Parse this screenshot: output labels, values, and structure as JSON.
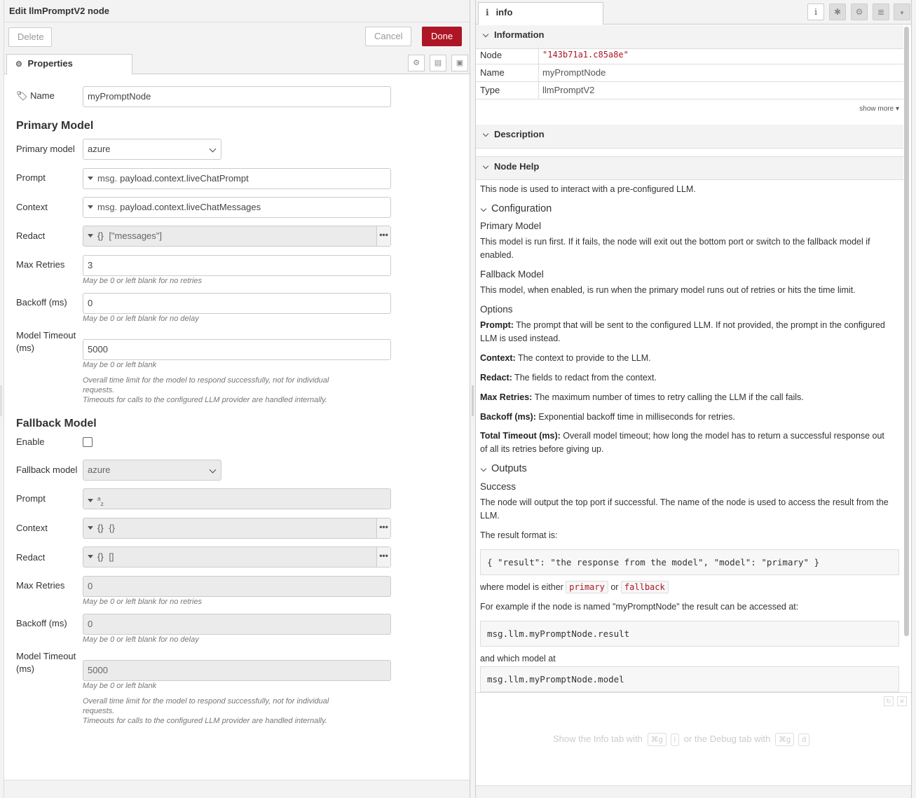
{
  "tray": {
    "title": "Edit llmPromptV2 node",
    "buttons": {
      "delete": "Delete",
      "cancel": "Cancel",
      "done": "Done"
    },
    "tab": "Properties",
    "name": {
      "label": "Name",
      "value": "myPromptNode"
    },
    "primary": {
      "heading": "Primary Model",
      "model_label": "Primary model",
      "model_value": "azure",
      "prompt_label": "Prompt",
      "prompt_type": "msg.",
      "prompt_value": "payload.context.liveChatPrompt",
      "context_label": "Context",
      "context_type": "msg.",
      "context_value": "payload.context.liveChatMessages",
      "redact_label": "Redact",
      "redact_type": "{}",
      "redact_value": "[\"messages\"]",
      "retries_label": "Max Retries",
      "retries_value": "3",
      "retries_help": "May be 0 or left blank for no retries",
      "backoff_label": "Backoff (ms)",
      "backoff_value": "0",
      "backoff_help": "May be 0 or left blank for no delay",
      "timeout_label_1": "Model Timeout",
      "timeout_label_2": "(ms)",
      "timeout_value": "5000",
      "timeout_help": "May be 0 or left blank",
      "timeout_note_1": "Overall time limit for the model to respond successfully, not for individual",
      "timeout_note_2": "requests.",
      "timeout_note_3": "Timeouts for calls to the configured LLM provider are handled internally."
    },
    "fallback": {
      "heading": "Fallback Model",
      "enable_label": "Enable",
      "model_label": "Fallback model",
      "model_value": "azure",
      "prompt_label": "Prompt",
      "prompt_type": "a",
      "prompt_type_sub": "z",
      "context_label": "Context",
      "context_type": "{}",
      "context_value": "{}",
      "redact_label": "Redact",
      "redact_type": "{}",
      "redact_value": "[]",
      "retries_label": "Max Retries",
      "retries_value": "0",
      "retries_help": "May be 0 or left blank for no retries",
      "backoff_label": "Backoff (ms)",
      "backoff_value": "0",
      "backoff_help": "May be 0 or left blank for no delay",
      "timeout_label_1": "Model Timeout",
      "timeout_label_2": "(ms)",
      "timeout_value": "5000",
      "timeout_help": "May be 0 or left blank",
      "timeout_note_1": "Overall time limit for the model to respond successfully, not for individual",
      "timeout_note_2": "requests.",
      "timeout_note_3": "Timeouts for calls to the configured LLM provider are handled internally."
    }
  },
  "sidebar": {
    "tab": "info",
    "information": {
      "heading": "Information",
      "rows": [
        {
          "key": "Node",
          "value": "\"143b71a1.c85a8e\""
        },
        {
          "key": "Name",
          "value": "myPromptNode"
        },
        {
          "key": "Type",
          "value": "llmPromptV2"
        }
      ],
      "show_more": "show more"
    },
    "description_heading": "Description",
    "help": {
      "heading": "Node Help",
      "intro": "This node is used to interact with a pre-configured LLM.",
      "configuration": "Configuration",
      "primary_h": "Primary Model",
      "primary_p1": "This model is run first. If it fails, the node will exit out the bottom port or switch to the fallback model if",
      "primary_p2": "enabled.",
      "fallback_h": "Fallback Model",
      "fallback_p": "This model, when enabled, is run when the primary model runs out of retries or hits the time limit.",
      "options_h": "Options",
      "prompt_b": "Prompt:",
      "prompt_t1": " The prompt that will be sent to the configured LLM. If not provided, the prompt in the configured",
      "prompt_t2": "LLM is used instead.",
      "context_b": "Context:",
      "context_t": " The context to provide to the LLM.",
      "redact_b": "Redact:",
      "redact_t": " The fields to redact from the context.",
      "retries_b": "Max Retries:",
      "retries_t": " The maximum number of times to retry calling the LLM if the call fails.",
      "backoff_b": "Backoff (ms):",
      "backoff_t": " Exponential backoff time in milliseconds for retries.",
      "total_b": "Total Timeout (ms):",
      "total_t1": " Overall model timeout; how long the model has to return a successful response out",
      "total_t2": "of all its retries before giving up.",
      "outputs": "Outputs",
      "success_h": "Success",
      "success_p1": "The node will output the top port if successful. The name of the node is used to access the result from the",
      "success_p2": "LLM.",
      "format_p": "The result format is:",
      "format_code": "{ \"result\": \"the response from the model\", \"model\": \"primary\" }",
      "where_pre": "where model is either ",
      "where_primary": "primary",
      "where_or": " or ",
      "where_fallback": "fallback",
      "example_p": "For example if the node is named \"myPromptNode\" the result can be accessed at:",
      "example_code": "msg.llm.myPromptNode.result",
      "which_p": "and which model at",
      "which_code": "msg.llm.myPromptNode.model"
    },
    "hint": {
      "pre": "Show the Info tab with",
      "k1": "⌘g",
      "k2": "i",
      "mid": "or the Debug tab with",
      "k3": "⌘g",
      "k4": "d"
    }
  }
}
